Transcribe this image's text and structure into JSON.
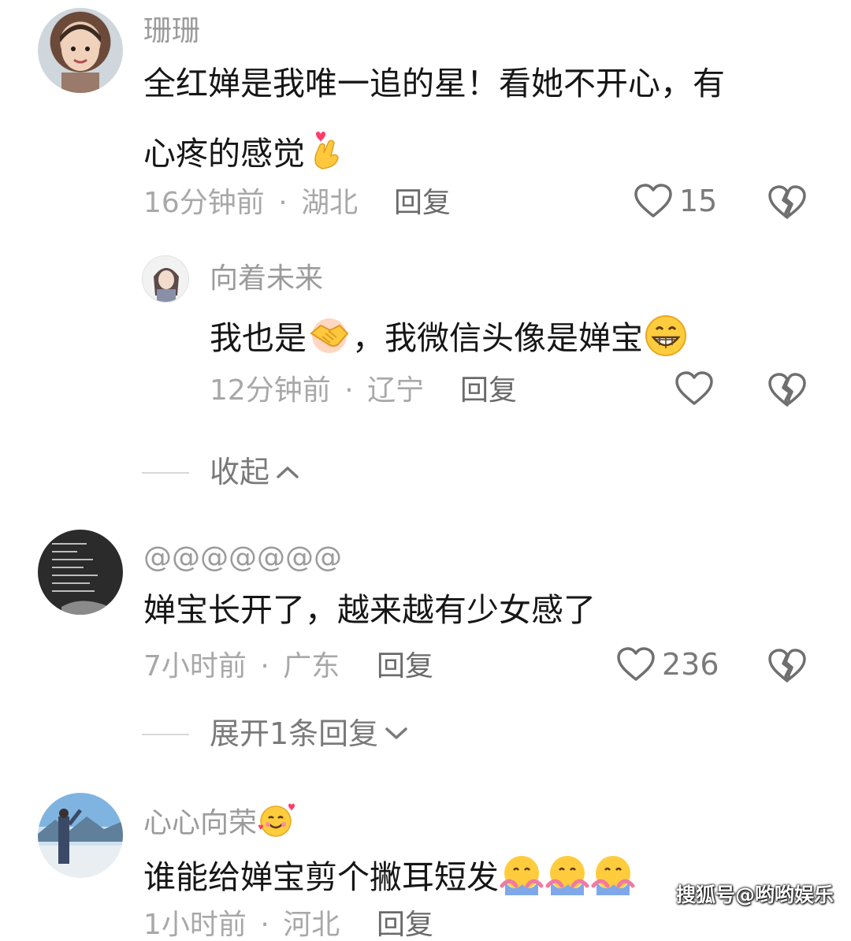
{
  "comments": [
    {
      "username": "珊珊",
      "text_line1": "全红婵是我唯一追的星！看她不开心，有",
      "text_line2": "心疼的感觉",
      "time": "16分钟前",
      "location": "湖北",
      "reply_label": "回复",
      "likes": "15",
      "replies": [
        {
          "username": "向着未来",
          "text_part1": "我也是",
          "text_part2": "，我微信头像是婵宝",
          "time": "12分钟前",
          "location": "辽宁",
          "reply_label": "回复"
        }
      ],
      "collapse_label": "收起"
    },
    {
      "username": "@@@@@@@",
      "text": "婵宝长开了，越来越有少女感了",
      "time": "7小时前",
      "location": "广东",
      "reply_label": "回复",
      "likes": "236",
      "expand_label": "展开1条回复"
    },
    {
      "username": "心心向荣",
      "text": "谁能给婵宝剪个撇耳短发",
      "time": "1小时前",
      "location": "河北",
      "reply_label": "回复"
    }
  ],
  "separator": "·",
  "watermark": "搜狐号@哟哟娱乐",
  "colors": {
    "text": "#161616",
    "muted": "#a8a8a8",
    "username": "#9b9b9b",
    "icon": "#6f6f6f"
  }
}
